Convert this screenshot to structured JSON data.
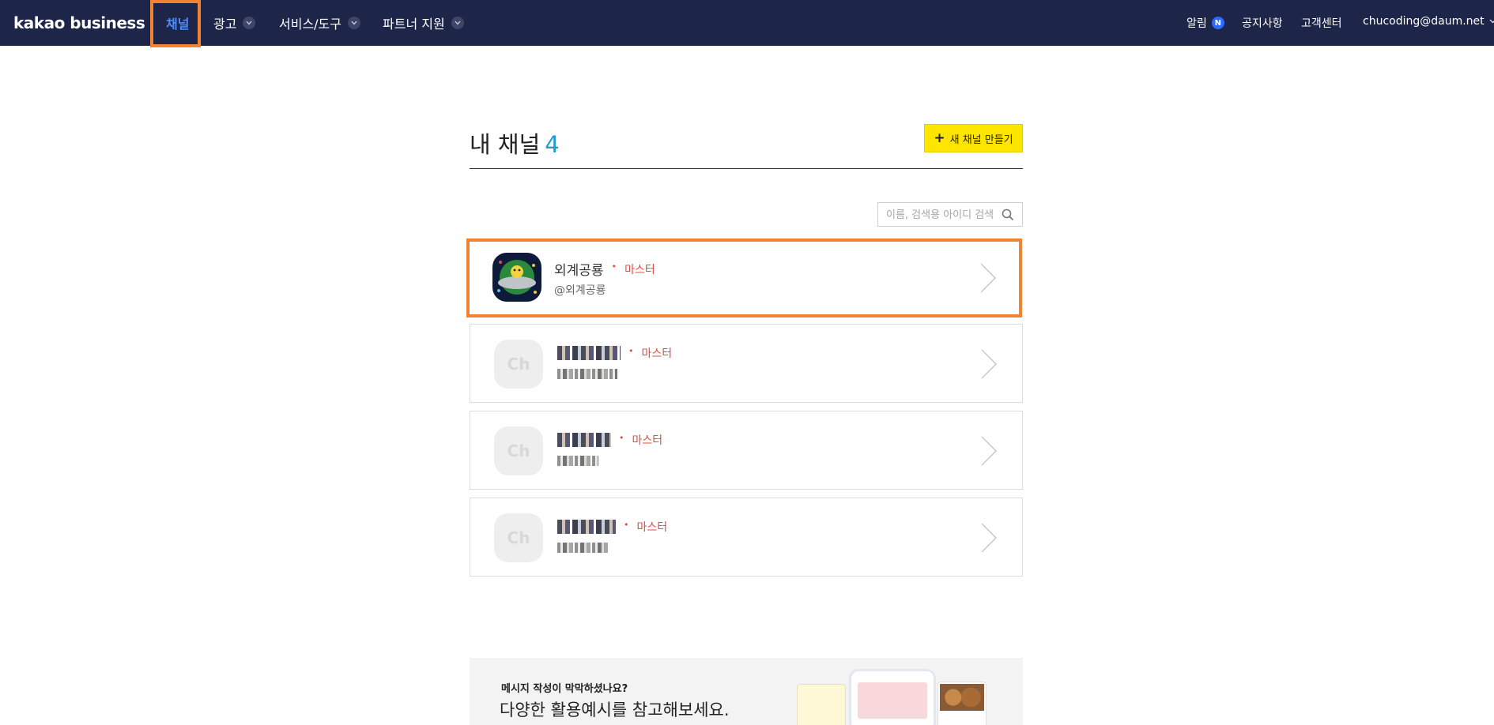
{
  "header": {
    "logo": "kakao business",
    "nav": [
      {
        "label": "채널",
        "active": true
      },
      {
        "label": "광고",
        "has_dropdown": true
      },
      {
        "label": "서비스/도구",
        "has_dropdown": true
      },
      {
        "label": "파트너 지원",
        "has_dropdown": true
      }
    ],
    "right": {
      "alarm_label": "알림",
      "alarm_badge": "N",
      "notice": "공지사항",
      "support": "고객센터",
      "account": "chucoding@daum.net"
    }
  },
  "main": {
    "title": "내 채널",
    "count": "4",
    "new_channel_label": "새 채널 만들기",
    "search_placeholder": "이름, 검색용 아이디 검색"
  },
  "channels": [
    {
      "name": "외계공룡",
      "id": "@외계공룡",
      "role": "마스터",
      "avatar": "dinosaur-avatar"
    },
    {
      "name": "",
      "id": "",
      "role": "마스터",
      "avatar_text": "Ch",
      "blurred": true
    },
    {
      "name": "",
      "id": "",
      "role": "마스터",
      "avatar_text": "Ch",
      "blurred": true
    },
    {
      "name": "",
      "id": "",
      "role": "마스터",
      "avatar_text": "Ch",
      "blurred": true
    }
  ],
  "promo": {
    "subtitle": "메시지 작성이 막막하셨나요?",
    "title": "다양한 활용예시를 참고해보세요."
  },
  "colors": {
    "header_bg": "#1d2548",
    "active_nav": "#4d8bff",
    "accent_yellow": "#fee500",
    "role_red": "#e24b40",
    "count_blue": "#1e9bcf",
    "highlight_orange": "#f28332"
  }
}
